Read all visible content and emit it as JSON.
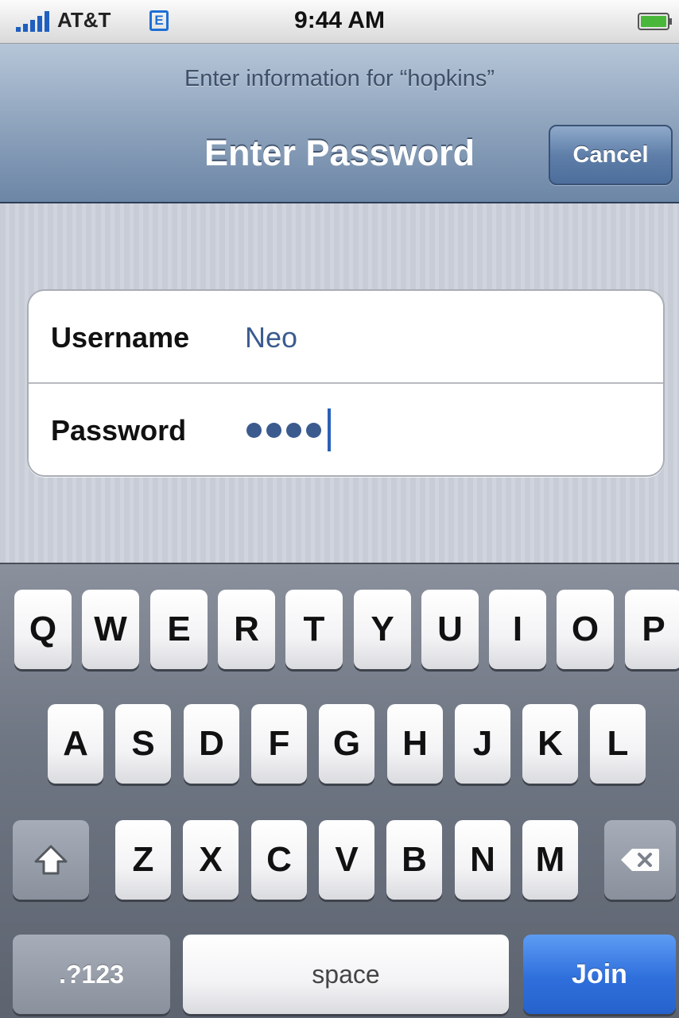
{
  "status_bar": {
    "carrier": "AT&T",
    "network_badge": "E",
    "time": "9:44 AM",
    "signal_icon": "signal-bars-icon",
    "battery_icon": "battery-icon"
  },
  "nav": {
    "prompt": "Enter information for “hopkins”",
    "title": "Enter Password",
    "cancel_label": "Cancel"
  },
  "form": {
    "username_label": "Username",
    "username_value": "Neo",
    "password_label": "Password",
    "password_masked_count": 4
  },
  "keyboard": {
    "row1": [
      "Q",
      "W",
      "E",
      "R",
      "T",
      "Y",
      "U",
      "I",
      "O",
      "P"
    ],
    "row2": [
      "A",
      "S",
      "D",
      "F",
      "G",
      "H",
      "J",
      "K",
      "L"
    ],
    "row3": [
      "Z",
      "X",
      "C",
      "V",
      "B",
      "N",
      "M"
    ],
    "shift_icon": "shift-arrow-icon",
    "delete_icon": "delete-backspace-icon",
    "numbers_label": ".?123",
    "space_label": "space",
    "join_label": "Join",
    "accent_color": "#2f6fdc"
  }
}
